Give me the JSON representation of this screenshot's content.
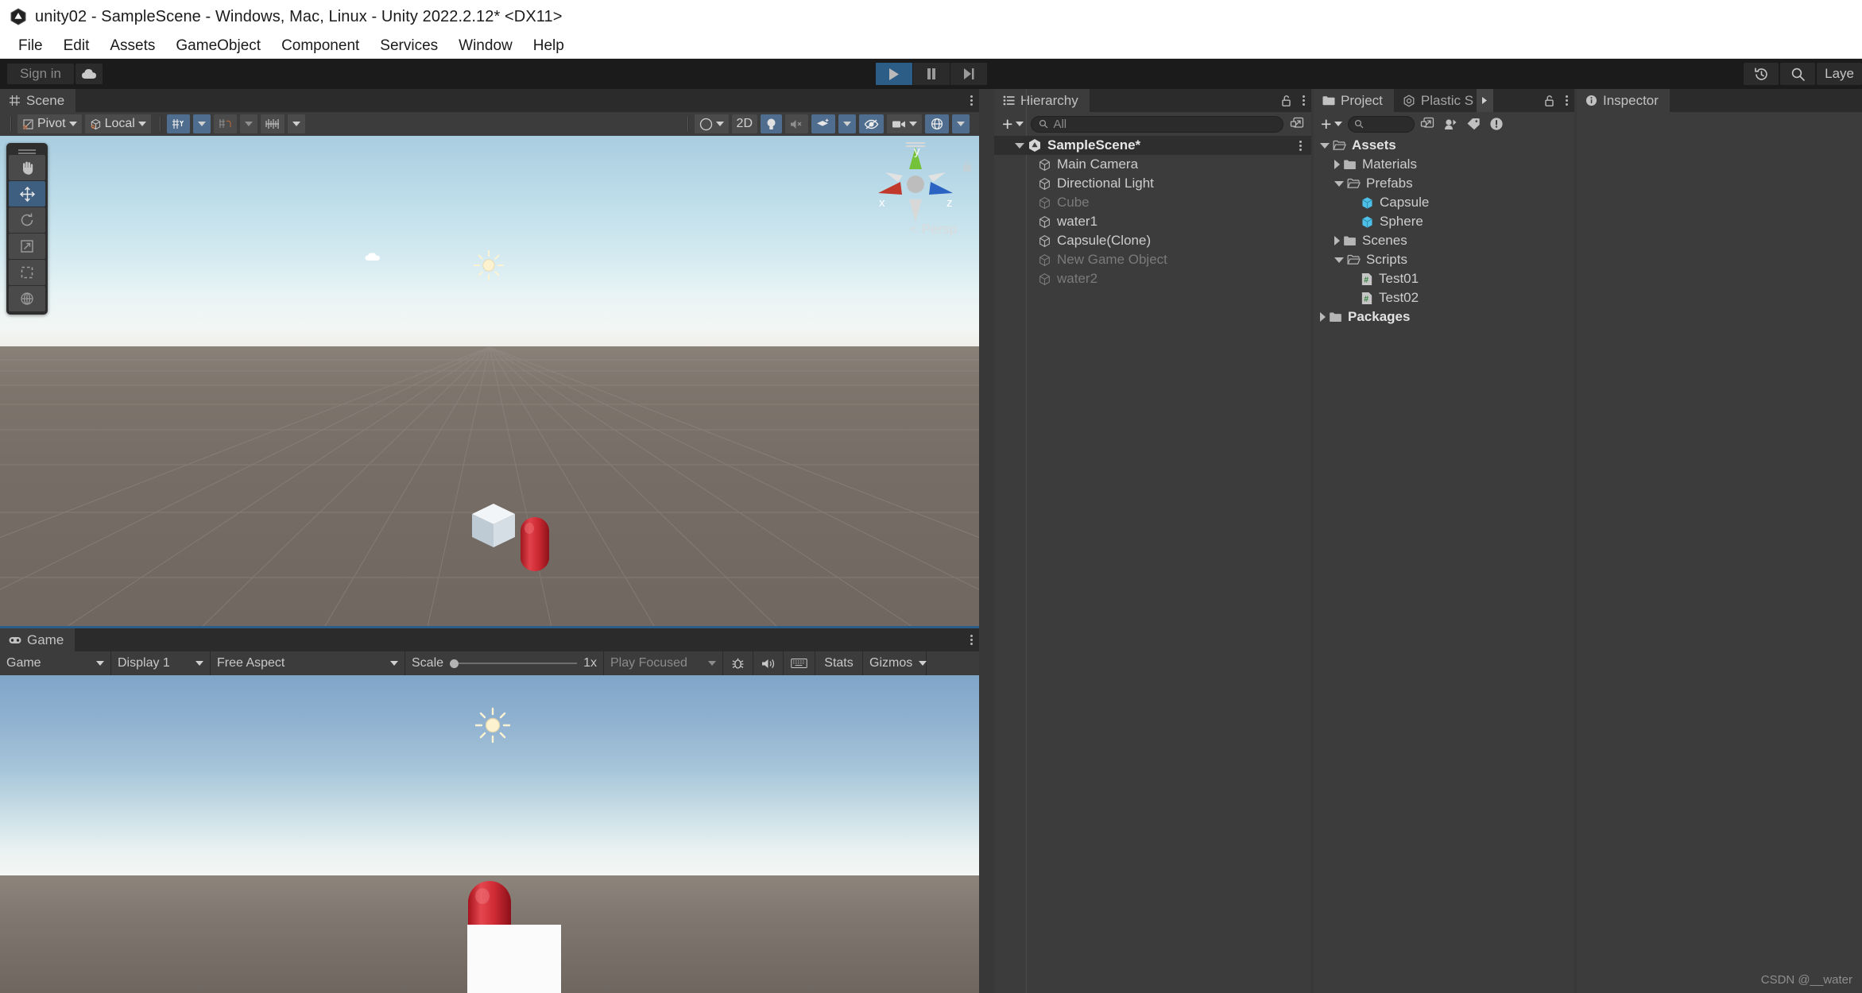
{
  "window": {
    "title": "unity02 - SampleScene - Windows, Mac, Linux - Unity 2022.2.12* <DX11>",
    "app_icon": "unity-logo-icon"
  },
  "menubar": {
    "items": [
      "File",
      "Edit",
      "Assets",
      "GameObject",
      "Component",
      "Services",
      "Window",
      "Help"
    ]
  },
  "toolbar": {
    "signin_label": "Sign in",
    "cloud_icon": "cloud-icon",
    "play_label": "play-icon",
    "pause_label": "pause-icon",
    "step_label": "step-icon",
    "history_icon": "history-icon",
    "search_icon": "search-icon",
    "layers_label": "Laye",
    "play_active": true,
    "accent_color": "#2c5d87"
  },
  "scene": {
    "tab_label": "Scene",
    "tab_icon": "scene-grid-icon",
    "toolbar": {
      "pivot_label": "Pivot",
      "pivot_icon": "pivot-icon",
      "handle_label": "Local",
      "handle_icon": "cube-local-icon",
      "grid_icon": "grid-axis-icon",
      "grid_dropdown_icon": "chevron-down-icon",
      "snap_icon": "snap-magnet-icon",
      "snap_dropdown_icon": "chevron-down-icon",
      "ruler_icon": "ruler-icon",
      "ruler_dropdown_icon": "chevron-down-icon",
      "shading_icon": "shading-sphere-icon",
      "twod_label": "2D",
      "light_icon": "lightbulb-icon",
      "audio_icon": "audio-muted-icon",
      "fx_icon": "effects-icon",
      "fx_dropdown_icon": "chevron-down-icon",
      "visibility_icon": "eye-off-icon",
      "camera_icon": "camera-icon",
      "camera_dropdown_icon": "chevron-down-icon",
      "gizmos_icon": "gizmos-globe-icon",
      "gizmos_dropdown_icon": "chevron-down-icon"
    },
    "tools": [
      {
        "name": "hand-tool",
        "icon": "hand-icon",
        "selected": false
      },
      {
        "name": "move-tool",
        "icon": "move-arrows-icon",
        "selected": true
      },
      {
        "name": "rotate-tool",
        "icon": "rotate-icon",
        "selected": false
      },
      {
        "name": "scale-tool",
        "icon": "scale-icon",
        "selected": false
      },
      {
        "name": "rect-tool",
        "icon": "rect-transform-icon",
        "selected": false
      },
      {
        "name": "transform-tool",
        "icon": "transform-combined-icon",
        "selected": false
      }
    ],
    "gizmo": {
      "x_label": "x",
      "y_label": "y",
      "z_label": "z",
      "projection_label": "Persp",
      "x_color": "#c4382e",
      "y_color": "#7ec832",
      "z_color": "#2d6fc9"
    },
    "objects": [
      {
        "name": "cube",
        "color": "#e2e7ea"
      },
      {
        "name": "capsule",
        "color": "#cd2f38"
      },
      {
        "name": "directional-light-gizmo",
        "color": "#fdf3d2"
      },
      {
        "name": "cloud-gizmo",
        "color": "#ffffff"
      }
    ]
  },
  "game": {
    "tab_label": "Game",
    "tab_icon": "game-controller-icon",
    "toolbar": {
      "view_label": "Game",
      "display_label": "Display 1",
      "aspect_label": "Free Aspect",
      "scale_label": "Scale",
      "scale_value": "1x",
      "focus_label": "Play Focused",
      "mute_icon": "bug-icon",
      "audio_icon": "speaker-icon",
      "stats_label": "Stats",
      "gizmos_label": "Gizmos",
      "keyboard_icon": "keyboard-icon",
      "dropdown_icon": "chevron-down-icon"
    }
  },
  "hierarchy": {
    "tab_label": "Hierarchy",
    "tab_icon": "hierarchy-list-icon",
    "lock_icon": "lock-open-icon",
    "menu_icon": "kebab-menu-icon",
    "add_label": "add-dropdown",
    "search_placeholder": "All",
    "search_icon": "search-icon",
    "expand_icon": "expand-window-icon",
    "items": [
      {
        "label": "SampleScene*",
        "depth": 0,
        "icon": "unity-scene-icon",
        "expanded": true,
        "disabled": false,
        "root": true
      },
      {
        "label": "Main Camera",
        "depth": 1,
        "icon": "gameobject-cube-icon",
        "disabled": false
      },
      {
        "label": "Directional Light",
        "depth": 1,
        "icon": "gameobject-cube-icon",
        "disabled": false
      },
      {
        "label": "Cube",
        "depth": 1,
        "icon": "gameobject-cube-icon",
        "disabled": true
      },
      {
        "label": "water1",
        "depth": 1,
        "icon": "gameobject-cube-icon",
        "disabled": false
      },
      {
        "label": "Capsule(Clone)",
        "depth": 1,
        "icon": "gameobject-cube-icon",
        "disabled": false
      },
      {
        "label": "New Game Object",
        "depth": 1,
        "icon": "gameobject-cube-icon",
        "disabled": true
      },
      {
        "label": "water2",
        "depth": 1,
        "icon": "gameobject-cube-icon",
        "disabled": true
      }
    ]
  },
  "project": {
    "tab_label": "Project",
    "tab_icon": "folder-icon",
    "tab2_label": "Plastic S",
    "tab2_icon": "plastic-scm-icon",
    "tab_overflow_icon": "chevron-right-icon",
    "lock_icon": "lock-open-icon",
    "menu_icon": "kebab-menu-icon",
    "search_icon": "search-icon",
    "expand_icon": "expand-window-icon",
    "favorite_icon": "avatar-icon",
    "label_icon": "tag-icon",
    "warning_icon": "alert-icon",
    "items": [
      {
        "label": "Assets",
        "depth": 0,
        "icon": "folder-open-icon",
        "arrow": "down",
        "bold": true
      },
      {
        "label": "Materials",
        "depth": 1,
        "icon": "folder-icon",
        "arrow": "right",
        "bold": false
      },
      {
        "label": "Prefabs",
        "depth": 1,
        "icon": "folder-open-icon",
        "arrow": "down",
        "bold": false
      },
      {
        "label": "Capsule",
        "depth": 2,
        "icon": "prefab-cube-icon",
        "arrow": "",
        "bold": false
      },
      {
        "label": "Sphere",
        "depth": 2,
        "icon": "prefab-cube-icon",
        "arrow": "",
        "bold": false
      },
      {
        "label": "Scenes",
        "depth": 1,
        "icon": "folder-icon",
        "arrow": "right",
        "bold": false
      },
      {
        "label": "Scripts",
        "depth": 1,
        "icon": "folder-open-icon",
        "arrow": "down",
        "bold": false
      },
      {
        "label": "Test01",
        "depth": 2,
        "icon": "csharp-script-icon",
        "arrow": "",
        "bold": false
      },
      {
        "label": "Test02",
        "depth": 2,
        "icon": "csharp-script-icon",
        "arrow": "",
        "bold": false
      },
      {
        "label": "Packages",
        "depth": 0,
        "icon": "folder-icon",
        "arrow": "right",
        "bold": true
      }
    ]
  },
  "inspector": {
    "tab_label": "Inspector",
    "tab_icon": "info-icon"
  },
  "watermark": {
    "text": "CSDN @__water"
  }
}
